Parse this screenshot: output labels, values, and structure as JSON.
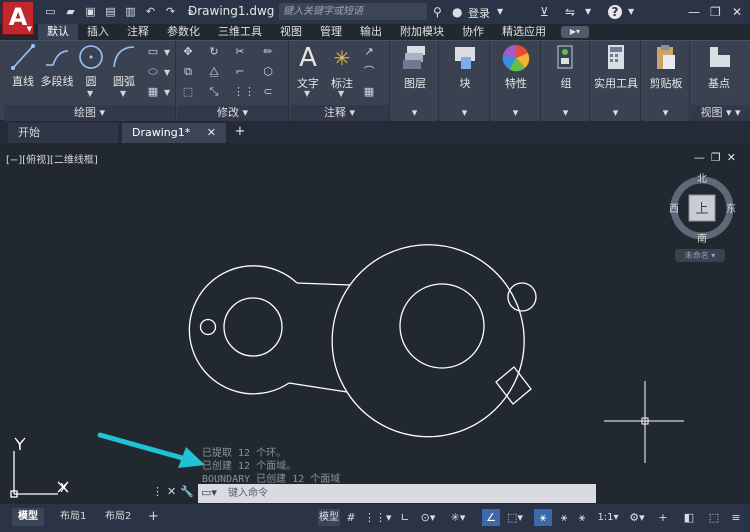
{
  "titlebar": {
    "doc_title": "Drawing1.dwg",
    "search_placeholder": "键入关键字或短语",
    "login_label": "登录"
  },
  "ribbon_tabs": [
    "默认",
    "插入",
    "注释",
    "参数化",
    "三维工具",
    "视图",
    "管理",
    "输出",
    "附加模块",
    "协作",
    "精选应用"
  ],
  "ribbon": {
    "draw": {
      "title": "绘图",
      "line": "直线",
      "polyline": "多段线",
      "circle": "圆",
      "arc": "圆弧"
    },
    "modify": {
      "title": "修改"
    },
    "annotation": {
      "title": "注释",
      "text": "文字",
      "dimension": "标注"
    },
    "layers": {
      "label": "图层"
    },
    "block": {
      "label": "块"
    },
    "properties": {
      "label": "特性"
    },
    "groups": {
      "label": "组"
    },
    "utilities": {
      "label": "实用工具"
    },
    "clipboard": {
      "label": "剪贴板"
    },
    "view": {
      "label": "基点",
      "title": "视图"
    }
  },
  "file_tabs": {
    "start": "开始",
    "doc": "Drawing1*"
  },
  "canvas": {
    "viewport_label": "[−][俯视][二维线框]",
    "viewcube": {
      "north": "北",
      "south": "南",
      "east": "东",
      "west": "西",
      "top": "上",
      "name": "未命名"
    },
    "ucs": {
      "y": "Y",
      "x": "X"
    }
  },
  "command": {
    "history": [
      "已提取 12 个环。",
      "已创建 12 个面域。",
      "BOUNDARY 已创建 12 个面域"
    ],
    "placeholder": "键入命令"
  },
  "layout_tabs": [
    "模型",
    "布局1",
    "布局2"
  ],
  "status": {
    "model": "模型",
    "scale": "1:1"
  },
  "colors": {
    "accent": "#c1272d",
    "annotation_arrow": "#1fc3d3",
    "canvas": "#212830"
  }
}
